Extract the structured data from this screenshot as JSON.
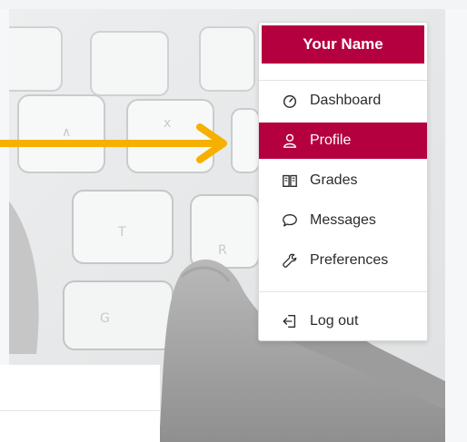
{
  "user_menu": {
    "header": "Your Name",
    "items": [
      {
        "label": "Dashboard",
        "icon": "dashboard-icon"
      },
      {
        "label": "Profile",
        "icon": "user-icon",
        "active": true
      },
      {
        "label": "Grades",
        "icon": "book-icon"
      },
      {
        "label": "Messages",
        "icon": "speech-bubble-icon"
      },
      {
        "label": "Preferences",
        "icon": "wrench-icon"
      }
    ],
    "logout_label": "Log out",
    "logout_icon": "logout-icon"
  },
  "colors": {
    "accent": "#b5003f",
    "arrow": "#f5b000",
    "menu_text": "#2b2b2b",
    "page_background": "#f6f7f9"
  }
}
